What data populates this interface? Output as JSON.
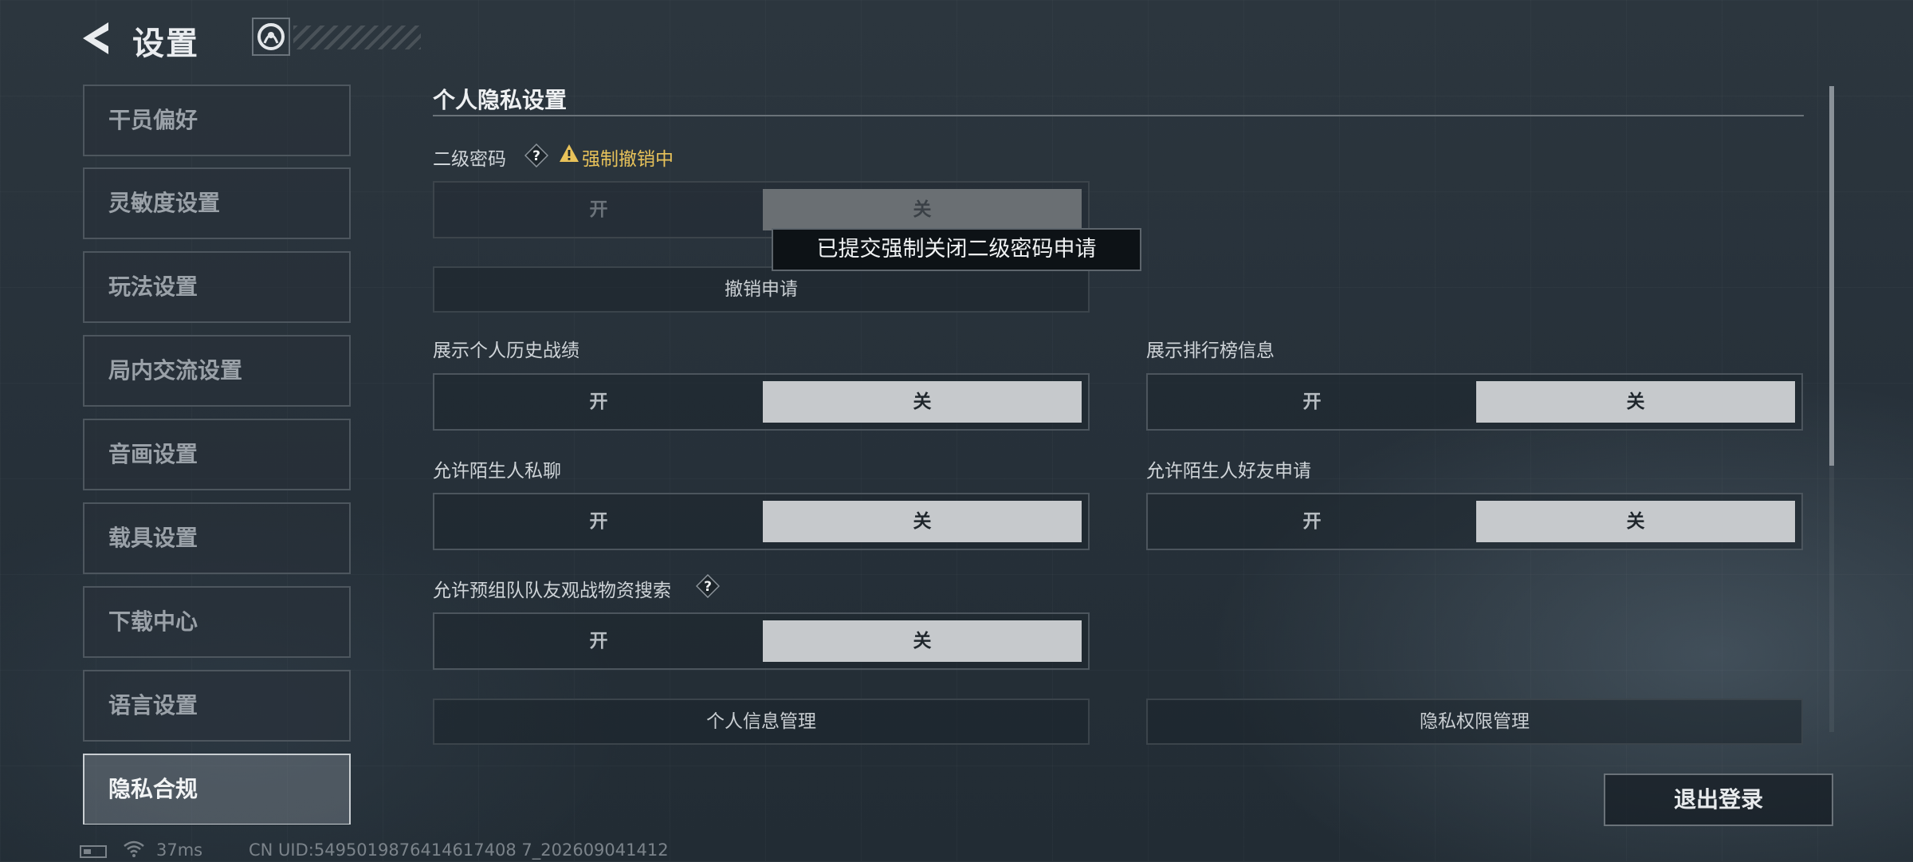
{
  "header": {
    "title": "设置"
  },
  "sidebar": {
    "items": [
      {
        "label": "干员偏好"
      },
      {
        "label": "灵敏度设置"
      },
      {
        "label": "玩法设置"
      },
      {
        "label": "局内交流设置"
      },
      {
        "label": "音画设置"
      },
      {
        "label": "载具设置"
      },
      {
        "label": "下载中心"
      },
      {
        "label": "语言设置"
      },
      {
        "label": "隐私合规",
        "active": true
      }
    ]
  },
  "main": {
    "section_title": "个人隐私设置",
    "secondary_password": {
      "label": "二级密码",
      "help": "?",
      "warning": "强制撤销中",
      "on": "开",
      "off": "关",
      "selected": "关",
      "cancel_request": "撤销申请"
    },
    "tooltip": "已提交强制关闭二级密码申请",
    "options": [
      {
        "label": "展示个人历史战绩",
        "on": "开",
        "off": "关",
        "selected": "关"
      },
      {
        "label": "展示排行榜信息",
        "on": "开",
        "off": "关",
        "selected": "关"
      },
      {
        "label": "允许陌生人私聊",
        "on": "开",
        "off": "关",
        "selected": "关"
      },
      {
        "label": "允许陌生人好友申请",
        "on": "开",
        "off": "关",
        "selected": "关"
      },
      {
        "label": "允许预组队队友观战物资搜索",
        "help": "?",
        "on": "开",
        "off": "关",
        "selected": "关"
      }
    ],
    "buttons": {
      "personal_info": "个人信息管理",
      "privacy_permissions": "隐私权限管理"
    }
  },
  "footer": {
    "logout": "退出登录",
    "ping": "37ms",
    "uid": "CN UID:5495019876414617408 7_202609041412"
  },
  "colors": {
    "background": "#27313a",
    "toggle_selected": "#c6c9cc",
    "warning": "#e8c25a",
    "active_item": "#c9ced2"
  },
  "icons": [
    "back-arrow-icon",
    "logo-icon",
    "help-icon",
    "warning-icon",
    "battery-icon",
    "wifi-icon"
  ]
}
